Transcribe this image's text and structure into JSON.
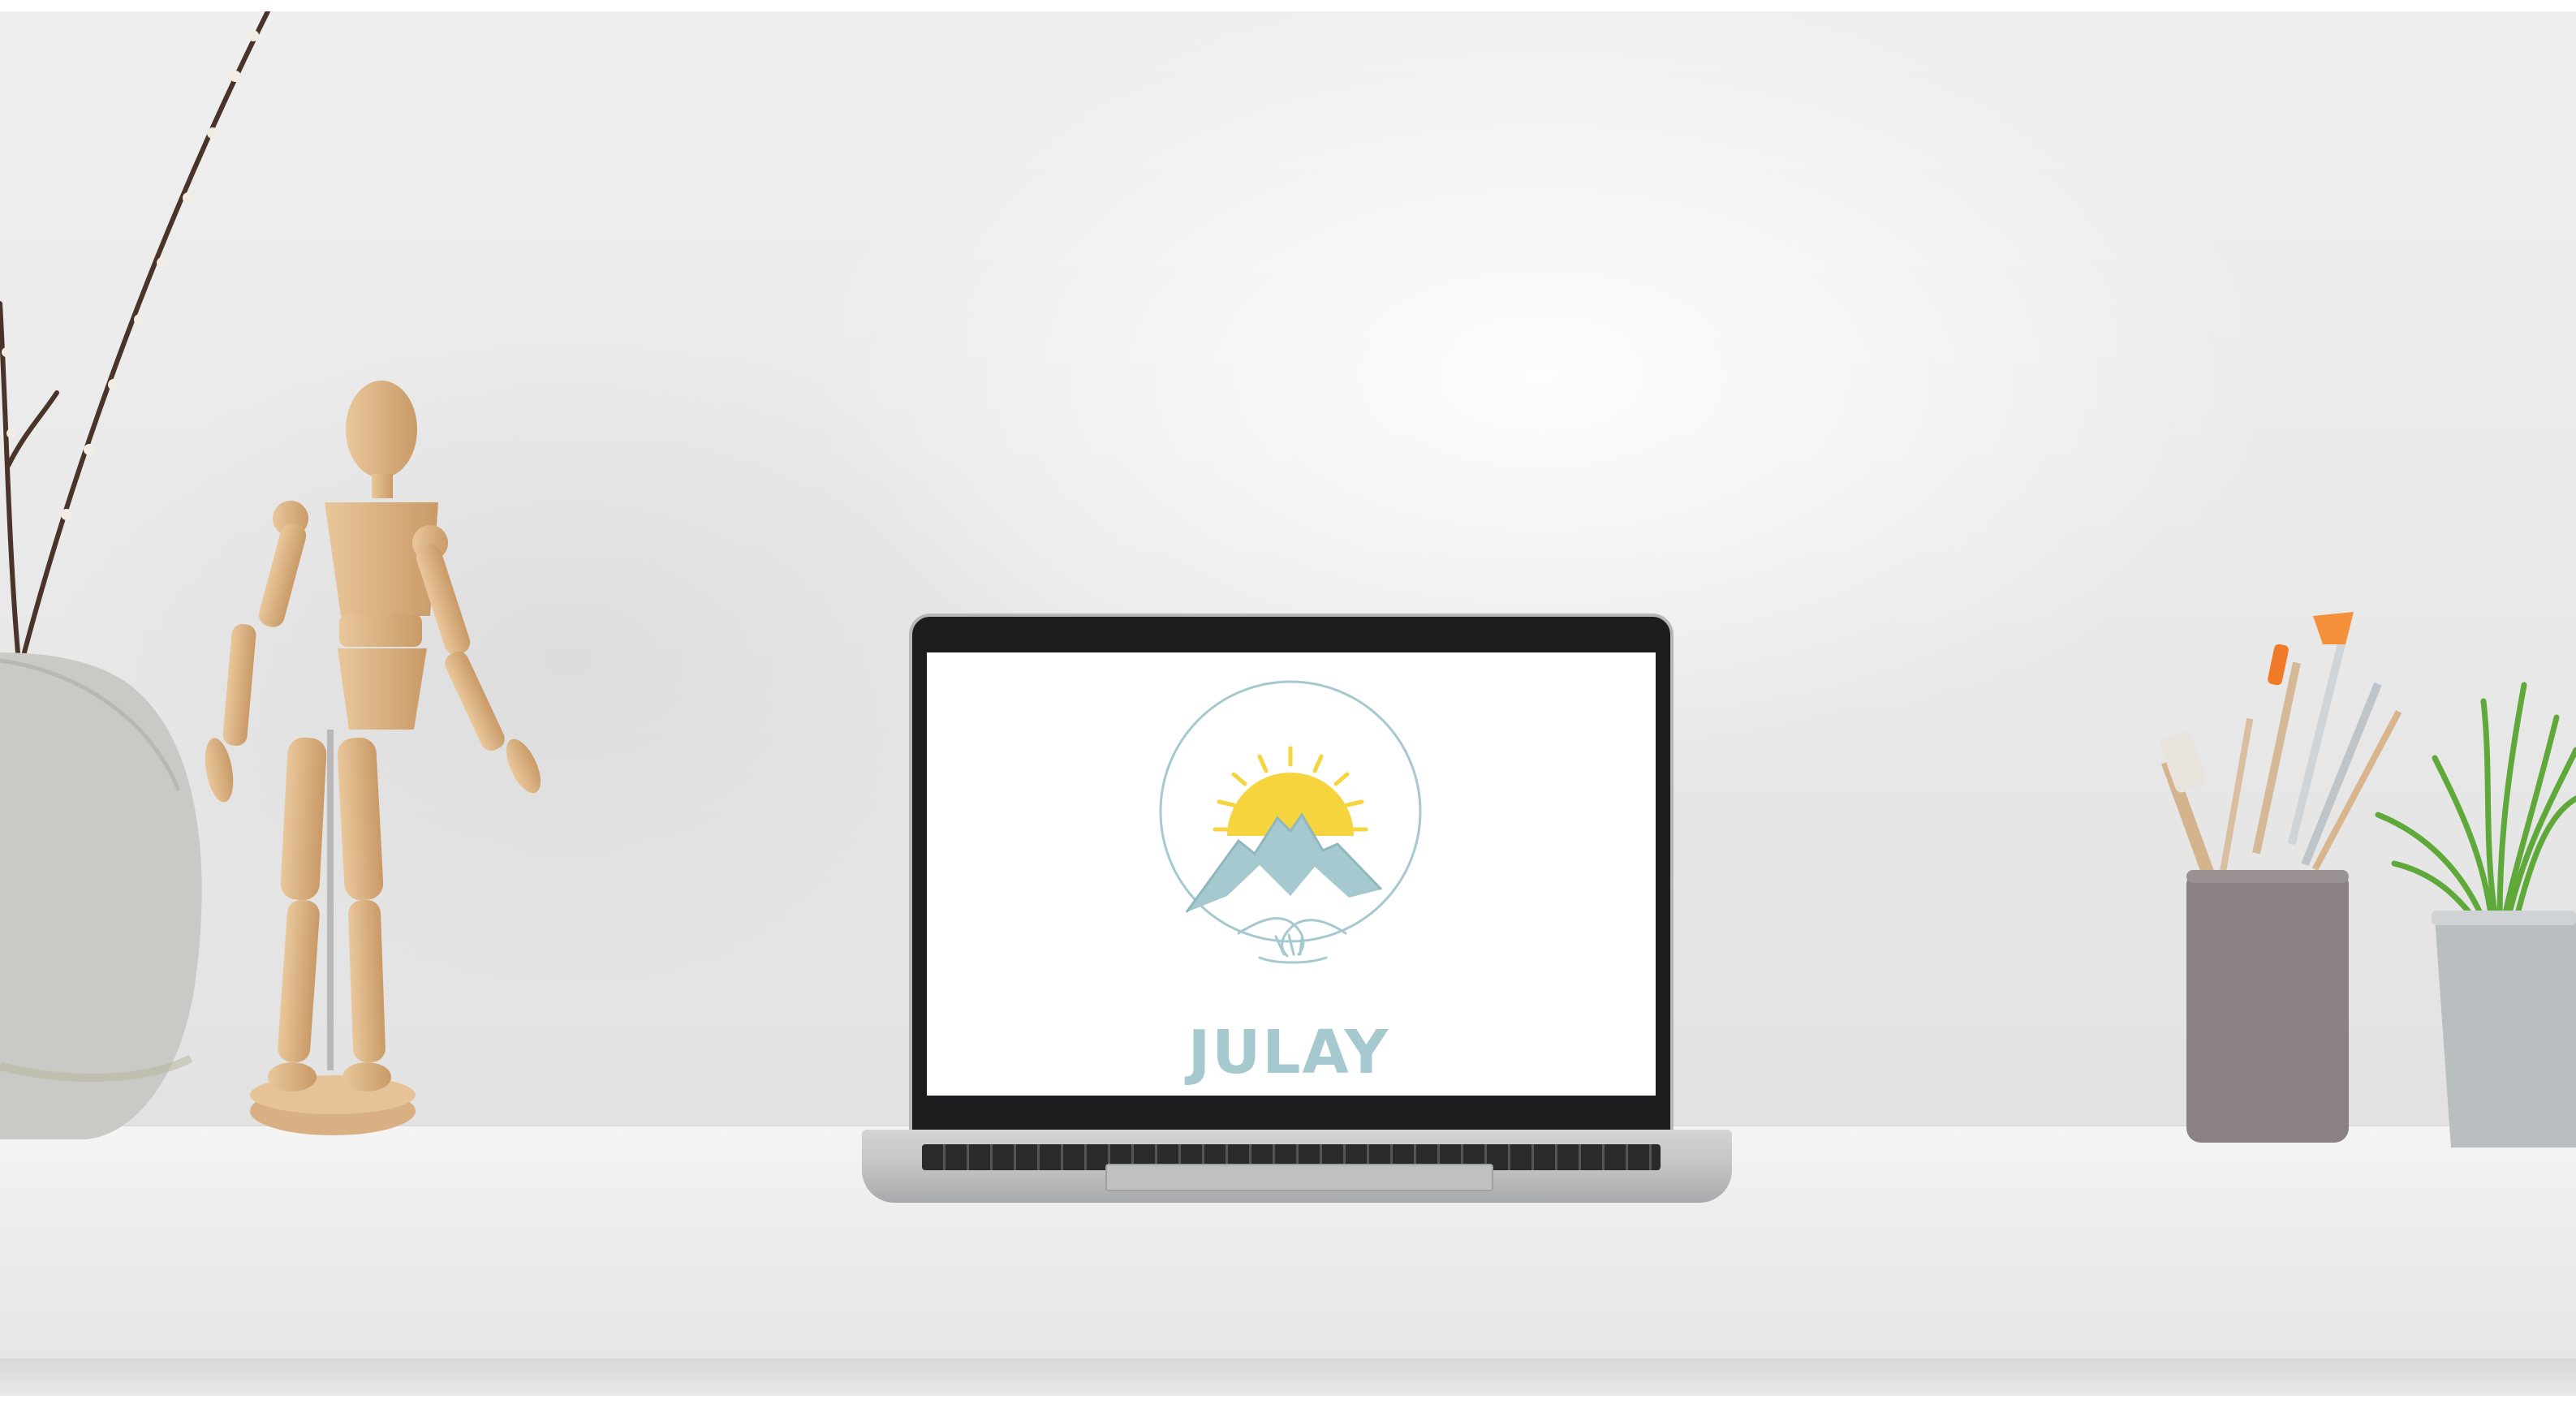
{
  "scene": "desk-mockup",
  "colors": {
    "wall": "#e9e9e9",
    "desk": "#efefef",
    "sun": "#f5d43e",
    "logo_teal": "#a6c9cf",
    "wood": "#dcb080",
    "pencil_cup": "#8a8282",
    "vase": "#c8c9c4",
    "plant_green": "#5fa83a",
    "planter": "#b9bec1"
  },
  "screen": {
    "logo_text": "JULAY"
  },
  "objects": {
    "left": [
      "vase-with-branches",
      "wooden-mannequin"
    ],
    "center": [
      "laptop"
    ],
    "right": [
      "brush-cup",
      "potted-plant"
    ]
  }
}
